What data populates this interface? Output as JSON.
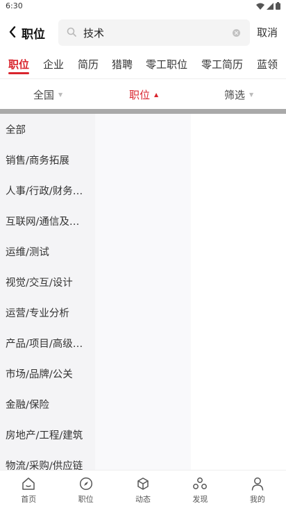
{
  "status_bar": {
    "time": "6:30"
  },
  "header": {
    "back_icon": "chevron-left-icon",
    "title": "职位",
    "search_value": "技术",
    "cancel_label": "取消"
  },
  "type_tabs": [
    {
      "label": "职位",
      "active": true
    },
    {
      "label": "企业"
    },
    {
      "label": "简历"
    },
    {
      "label": "猎聘"
    },
    {
      "label": "零工职位"
    },
    {
      "label": "零工简历"
    },
    {
      "label": "蓝领"
    }
  ],
  "filters": [
    {
      "label": "全国",
      "caret": "▼"
    },
    {
      "label": "职位",
      "caret": "▲",
      "active": true
    },
    {
      "label": "筛选",
      "caret": "▼"
    }
  ],
  "categories": [
    "全部",
    "销售/商务拓展",
    "人事/行政/财务…",
    "互联网/通信及…",
    "运维/测试",
    "视觉/交互/设计",
    "运营/专业分析",
    "产品/项目/高级…",
    "市场/品牌/公关",
    "金融/保险",
    "房地产/工程/建筑",
    "物流/采购/供应链"
  ],
  "bottom_nav": [
    {
      "label": "首页",
      "icon": "home-icon"
    },
    {
      "label": "职位",
      "icon": "compass-icon"
    },
    {
      "label": "动态",
      "icon": "cube-icon"
    },
    {
      "label": "发现",
      "icon": "discover-icon"
    },
    {
      "label": "我的",
      "icon": "user-icon"
    }
  ],
  "colors": {
    "accent": "#d9242d"
  }
}
